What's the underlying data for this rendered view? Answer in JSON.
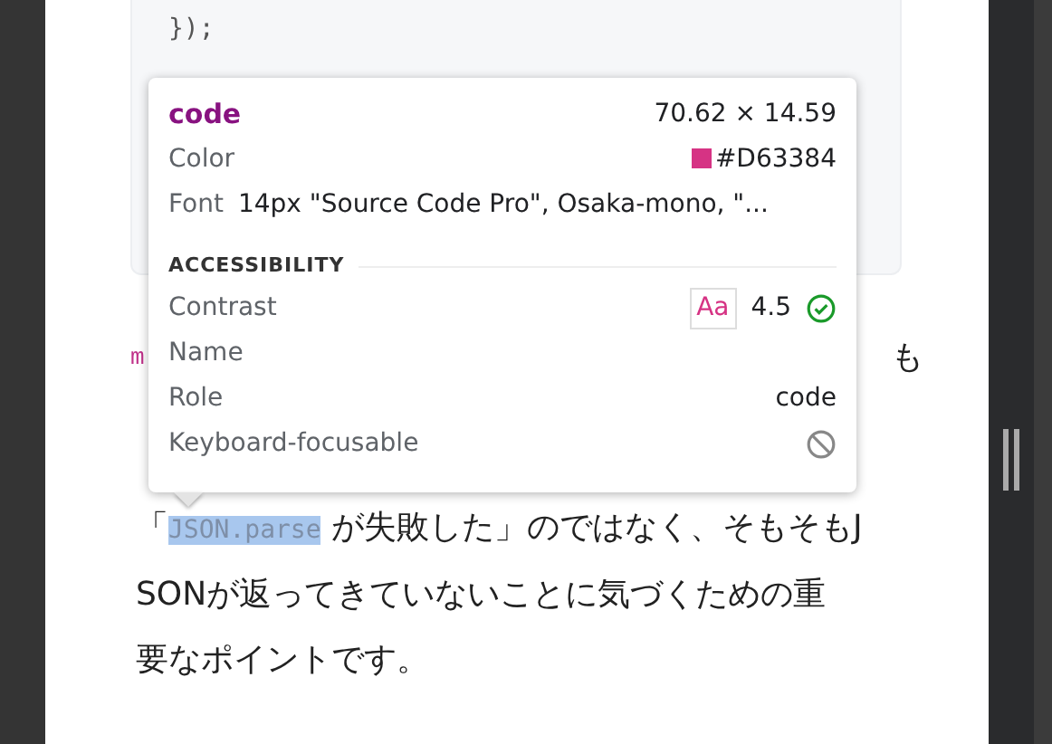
{
  "code_block": {
    "text": "});"
  },
  "partial_line": {
    "code_fragment": "m",
    "end_char": "も"
  },
  "paragraph": {
    "lines": [
      [
        {
          "kind": "text",
          "text": "「"
        },
        {
          "kind": "code",
          "text": "JSON.parse",
          "selected": true
        },
        {
          "kind": "text",
          "text": " が失敗した」のではなく、そもそもJ"
        }
      ],
      [
        {
          "kind": "text",
          "text": "SONが返ってきていないことに気づくための重"
        }
      ],
      [
        {
          "kind": "text",
          "text": "要なポイントです。"
        }
      ]
    ]
  },
  "tooltip": {
    "tag": "code",
    "size": "70.62 × 14.59",
    "color_label": "Color",
    "color_value": "#D63384",
    "color": "#d63384",
    "font_label": "Font",
    "font_value": "14px \"Source Code Pro\", Osaka-mono, \"...",
    "section": "ACCESSIBILITY",
    "rows": [
      {
        "kind": "contrast",
        "label": "Contrast",
        "badge": "Aa",
        "value": "4.5",
        "pass": true
      },
      {
        "kind": "text",
        "label": "Name"
      },
      {
        "kind": "text",
        "label": "Role",
        "value": "code"
      },
      {
        "kind": "focusable",
        "label": "Keyboard-focusable",
        "focusable": false
      }
    ]
  }
}
